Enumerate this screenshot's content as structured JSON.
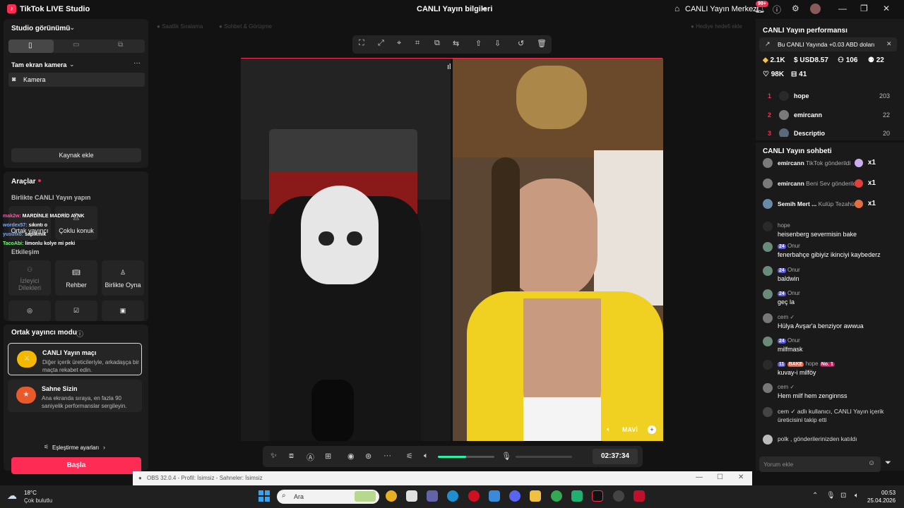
{
  "titlebar": {
    "app_title": "TikTok LIVE Studio",
    "center_title": "CANLI Yayın bilgileri",
    "live_center": "CANLI Yayın Merkezi",
    "notif_badge": "99+"
  },
  "left": {
    "studio_view": "Studio görünümü",
    "fullscreen_camera": "Tam ekran kamera",
    "camera_item": "Kamera",
    "add_source": "Kaynak ekle",
    "tools_title": "Araçlar",
    "live_together": "Birlikte CANLI Yayın yapın",
    "cohost": "Ortak yayıncı",
    "multi_guest": "Çoklu konuk",
    "interaction": "Etkileşim",
    "tiles": [
      "İzleyici Dilekleri",
      "Rehber",
      "Birlikte Oyna"
    ],
    "cohost_mode": "Ortak yayıncı modu",
    "card1_title": "CANLI Yayın maçı",
    "card1_desc": "Diğer içerik üreticileriyle, arkadaşça bir maçta rekabet edin.",
    "card2_title": "Sahne Sizin",
    "card2_desc": "Ana ekranda sıraya, en fazla 90 saniyelik performanslar sergileyin.",
    "match_settings": "Eşleştirme ayarları",
    "start": "Başla"
  },
  "overlay_chat": [
    {
      "user": "mak2w:",
      "text": "MARDİNLE MADRİD AYNK"
    },
    {
      "user": "wordex57:",
      "text": "sıkıntı o"
    },
    {
      "user": "yusufxo:",
      "text": "sapıkmık"
    },
    {
      "user": "TacoAbi:",
      "text": "limonlu kolye mi peki"
    }
  ],
  "preview": {
    "top_left_1": "Saatlik Sıralama",
    "top_left_2": "Sohbet & Görüşme",
    "top_right": "Hediye hedefi ekle",
    "guest_name": "MAVİ",
    "timer": "02:37:34"
  },
  "performance": {
    "title": "CANLI Yayın performansı",
    "banner": "Bu CANLI Yayında +0.03 ABD doları",
    "diamonds": "2.1K",
    "usd": "USD8.57",
    "viewers": "106",
    "new": "22",
    "likes": "98K",
    "gifts": "41",
    "ranking": [
      {
        "rank": "1",
        "name": "hope",
        "value": "203"
      },
      {
        "rank": "2",
        "name": "emircann",
        "value": "22"
      },
      {
        "rank": "3",
        "name": "Descriptio",
        "value": "20"
      }
    ]
  },
  "chat": {
    "title": "CANLI Yayın sohbeti",
    "gifts": [
      {
        "user": "emircann",
        "text": "TikTok gönderildi",
        "count": "x1"
      },
      {
        "user": "emircann",
        "text": "Beni Sev gönderildi",
        "count": "x1"
      },
      {
        "user": "Semih Mert ...",
        "text": "Kulüp Tezahürat",
        "count": "x1"
      }
    ],
    "messages": [
      {
        "head": "hope",
        "body": "heisenberg severmisin bake"
      },
      {
        "head": "Onur",
        "level": "24",
        "body": "fenerbahçe gibiyiz ikinciyi kaybederz"
      },
      {
        "head": "Onur",
        "level": "24",
        "body": "baldwin"
      },
      {
        "head": "Onur",
        "level": "24",
        "body": "geç la"
      },
      {
        "head": "cem ✓",
        "body": "Hülya Avşar'a benziyor awwua"
      },
      {
        "head": "Onur",
        "level": "24",
        "body": "milfmask"
      },
      {
        "head": "hope",
        "level": "11",
        "tag2": "BAKE",
        "tag": "No. 1",
        "body": "kuvay-i milföy"
      },
      {
        "head": "cem ✓",
        "body": "Hem milf hem zenginnss"
      }
    ],
    "follow_line1": "cem ✓ adlı kullanıcı, CANLI Yayın içerik",
    "follow_line2": "üreticisini takip etti",
    "joined": "polk , gönderilerinizden katıldı",
    "comment_placeholder": "Yorum ekle"
  },
  "obs": {
    "title": "OBS 32.0.4 - Profil: İsimsiz - Sahneler: İsimsiz"
  },
  "taskbar": {
    "weather_temp": "18°C",
    "weather_desc": "Çok bulutlu",
    "search": "Ara",
    "time": "00:53",
    "date": "25.04.2026"
  }
}
